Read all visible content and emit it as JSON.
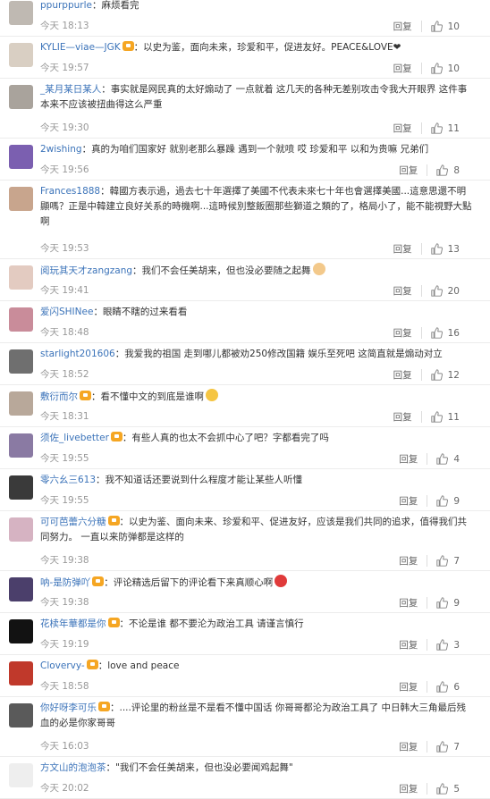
{
  "reply_label": "回复",
  "comments": [
    {
      "user": "ppurppurle",
      "vip": false,
      "text": "麻烦看完",
      "time": "今天 18:13",
      "likes": "10",
      "avatar": "#bfb9b2",
      "emoji": null
    },
    {
      "user": "KYLIE—viae—JGK",
      "vip": true,
      "text": "以史为鉴，面向未来，珍爱和平，促进友好。PEACE&LOVE❤",
      "time": "今天 19:57",
      "likes": "10",
      "avatar": "#d9cfc3",
      "emoji": null
    },
    {
      "user": "_某月某日某人",
      "vip": false,
      "text": "事实就是网民真的太好煽动了 一点就着 这几天的各种无差别攻击令我大开眼界 这件事本来不应该被扭曲得这么严重",
      "time": "今天 19:30",
      "likes": "11",
      "avatar": "#a9a39c",
      "emoji": null
    },
    {
      "user": "2wishing",
      "vip": false,
      "text": "真的为咱们国家好 就别老那么暴躁 遇到一个就喷 哎 珍爱和平 以和为贵嘛 兄弟们",
      "time": "今天 19:56",
      "likes": "8",
      "avatar": "#7b5fb0",
      "emoji": null
    },
    {
      "user": "Frances1888",
      "vip": false,
      "text": "韓國方表示過，過去七十年選擇了美國不代表未來七十年也會選擇美國...這意思還不明顯嗎？正是中韓建立良好关系的時機啊...這時候別整飯圈那些獅道之類的了，格局小了，能不能視野大點啊",
      "time": "今天 19:53",
      "likes": "13",
      "avatar": "#c8a58d",
      "emoji": null
    },
    {
      "user": "阅玩其天才zangzang",
      "vip": false,
      "text": "我们不会任美胡来，但也没必要随之起舞",
      "time": "今天 19:41",
      "likes": "20",
      "avatar": "#e3cbc1",
      "emoji": "#f3c98b"
    },
    {
      "user": "爱闪SHINee",
      "vip": false,
      "text": "眼睛不瞎的过来看看",
      "time": "今天 18:48",
      "likes": "16",
      "avatar": "#c98c9a",
      "emoji": null
    },
    {
      "user": "starlight201606",
      "vip": false,
      "text": "我爱我的祖国 走到哪儿都被劝250修改国籍 娱乐至死吧 这简直就是煽动对立",
      "time": "今天 18:52",
      "likes": "12",
      "avatar": "#6f6f6f",
      "emoji": null
    },
    {
      "user": "敷衍而尔",
      "vip": true,
      "text": "看不懂中文的到底是谁啊",
      "time": "今天 18:31",
      "likes": "11",
      "avatar": "#b8a89a",
      "emoji": "#f5c542"
    },
    {
      "user": "须佐_livebetter",
      "vip": true,
      "text": "有些人真的也太不会抓中心了吧？字都看完了吗",
      "time": "今天 19:55",
      "likes": "4",
      "avatar": "#8a7aa3",
      "emoji": null
    },
    {
      "user": "零六幺三613",
      "vip": false,
      "text": "我不知道话还要说到什么程度才能让某些人听懂",
      "time": "今天 19:55",
      "likes": "9",
      "avatar": "#3a3a3a",
      "emoji": null
    },
    {
      "user": "可可芭蕾六分糖",
      "vip": true,
      "text": "以史为鉴、面向未来、珍爱和平、促进友好，应该是我们共同的追求，值得我们共同努力。 一直以来防弹都是这样的",
      "time": "今天 19:38",
      "likes": "7",
      "avatar": "#d6b3c2",
      "emoji": null
    },
    {
      "user": "呐-是防弹吖",
      "vip": true,
      "text": "评论精选后留下的评论看下来真顺心啊",
      "time": "今天 19:38",
      "likes": "9",
      "avatar": "#4b3f6b",
      "emoji": "#e03a3a"
    },
    {
      "user": "花椟年華都是你",
      "vip": true,
      "text": "不论是谁 都不要沦为政治工具 请谨言慎行",
      "time": "今天 19:19",
      "likes": "3",
      "avatar": "#121212",
      "emoji": null
    },
    {
      "user": "Clovervy-",
      "vip": true,
      "text": "love and peace",
      "time": "今天 18:58",
      "likes": "6",
      "avatar": "#c0392b",
      "emoji": null
    },
    {
      "user": "你好呀李可乐",
      "vip": true,
      "text": "....评论里的粉丝是不是看不懂中国话 你哥哥都沦为政治工具了 中日韩大三角最后残血的必是你家哥哥",
      "time": "今天 16:03",
      "likes": "7",
      "avatar": "#5a5a5a",
      "emoji": null
    },
    {
      "user": "方文山的泡泡茶",
      "vip": false,
      "text": "\"我们不会任美胡来，但也没必要闻鸡起舞\"",
      "time": "今天 20:02",
      "likes": "5",
      "avatar": "#eeeeee",
      "emoji": null
    }
  ]
}
